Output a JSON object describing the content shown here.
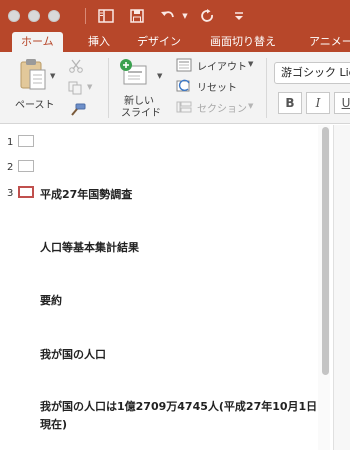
{
  "colors": {
    "accent": "#b7472a",
    "ribbon_bg": "#f3f3f3",
    "selected_slide": "#c0504d"
  },
  "quick_access": {
    "icons": [
      "sidebar-toggle-icon",
      "save-icon",
      "undo-icon",
      "redo-icon",
      "customize-toolbar-icon"
    ]
  },
  "tabs": [
    {
      "label": "ホーム",
      "active": true
    },
    {
      "label": "挿入"
    },
    {
      "label": "デザイン"
    },
    {
      "label": "画面切り替え"
    },
    {
      "label": "アニメー"
    }
  ],
  "ribbon": {
    "paste_label": "ペースト",
    "new_slide_label_line1": "新しい",
    "new_slide_label_line2": "スライド",
    "layout_label": "レイアウト",
    "reset_label": "リセット",
    "section_label": "セクション",
    "font_name": "游ゴシック Lig",
    "bold_label": "B",
    "italic_label": "I",
    "underline_label": "U"
  },
  "outline": {
    "slides": [
      {
        "number": "1"
      },
      {
        "number": "2"
      },
      {
        "number": "3",
        "selected": true,
        "title": "平成27年国勢調査"
      }
    ],
    "bullets": [
      "人口等基本集計結果",
      "要約",
      "我が国の人口",
      "我が国の人口は1億2709万4745人(平成27年10月1日現在)"
    ]
  }
}
